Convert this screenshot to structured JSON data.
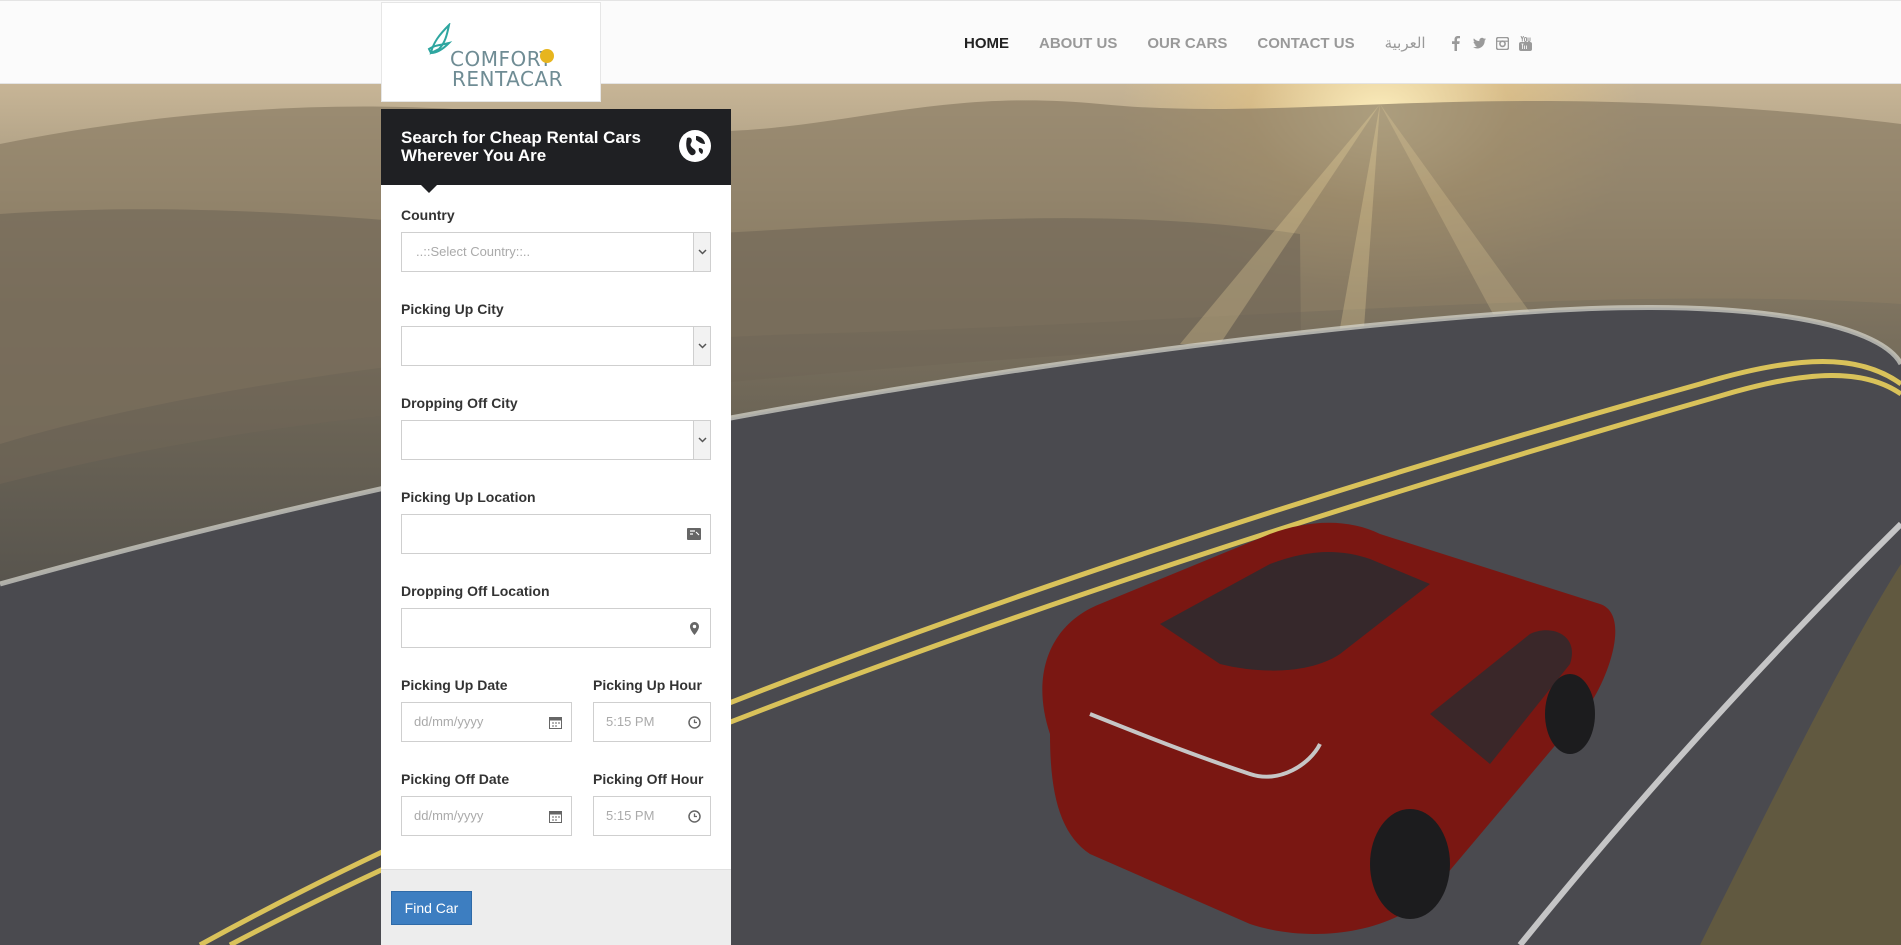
{
  "logo": {
    "line1": "COMFORT",
    "line2": "RENTACAR"
  },
  "nav": {
    "home": "HOME",
    "about": "ABOUT US",
    "cars": "OUR CARS",
    "contact": "CONTACT US",
    "language": "العربية"
  },
  "social": [
    "facebook-icon",
    "twitter-icon",
    "instagram-icon",
    "youtube-icon"
  ],
  "search": {
    "title": "Search for Cheap Rental Cars Wherever You Are",
    "country_label": "Country",
    "country_placeholder": "..::Select Country::..",
    "pickup_city_label": "Picking Up City",
    "pickup_city_value": "",
    "dropoff_city_label": "Dropping Off City",
    "dropoff_city_value": "",
    "pickup_location_label": "Picking Up Location",
    "pickup_location_value": "",
    "dropoff_location_label": "Dropping Off Location",
    "dropoff_location_value": "",
    "pickup_date_label": "Picking Up Date",
    "pickup_date_placeholder": "dd/mm/yyyy",
    "pickup_hour_label": "Picking Up Hour",
    "pickup_hour_value": "5:15 PM",
    "pickoff_date_label": "Picking Off Date",
    "pickoff_date_placeholder": "dd/mm/yyyy",
    "pickoff_hour_label": "Picking Off Hour",
    "pickoff_hour_value": "5:15 PM",
    "submit_label": "Find Car"
  },
  "colors": {
    "panel_header": "#1f2023",
    "button": "#3d7ec1",
    "nav_active": "#222222",
    "nav_inactive": "#999999"
  }
}
